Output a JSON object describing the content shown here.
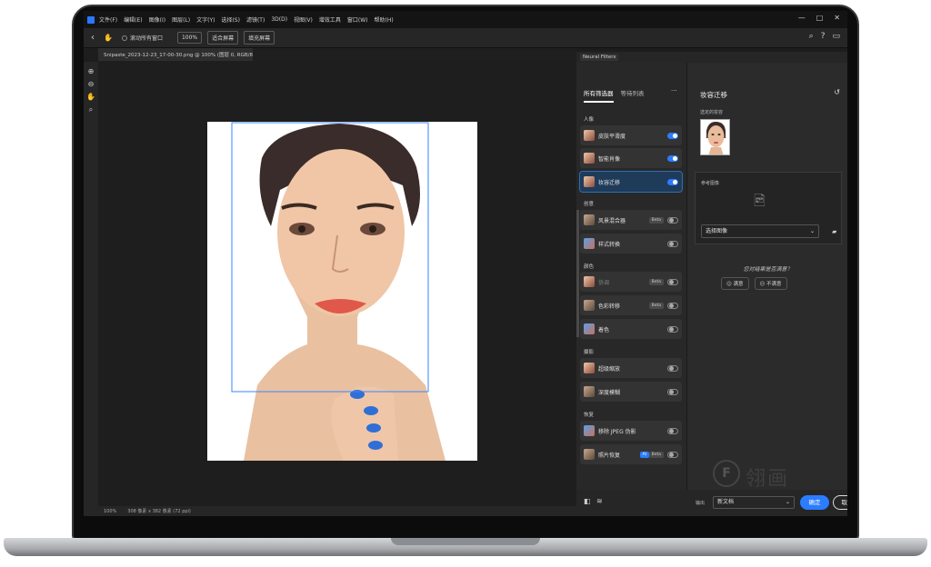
{
  "menubar": {
    "items": [
      "文件(F)",
      "编辑(E)",
      "图像(I)",
      "图层(L)",
      "文字(Y)",
      "选择(S)",
      "滤镜(T)",
      "3D(D)",
      "视图(V)",
      "增效工具",
      "窗口(W)",
      "帮助(H)"
    ],
    "window_controls": [
      "—",
      "□",
      "✕"
    ]
  },
  "optbar": {
    "back": "‹",
    "hand": "✋",
    "scroll_all": "滚动所有窗口",
    "zoom": "100%",
    "fit_screen": "适合屏幕",
    "fill_screen": "填充屏幕"
  },
  "document": {
    "tab_title": "Snipaste_2023-12-23_17-00-30.png @ 100% (图层 0, RGB/8#) *",
    "status_zoom": "100%",
    "status_size": "308 像素 x 382 像素 (72 ppi)"
  },
  "neural": {
    "header_tab": "Neural Filters",
    "tabs": [
      "所有筛选器",
      "等待列表"
    ],
    "more": "···",
    "categories": {
      "portrait": "人像",
      "creative": "创意",
      "color": "颜色",
      "photography": "摄影",
      "restoration": "恢复"
    },
    "filters": [
      {
        "label": "皮肤平滑度"
      },
      {
        "label": "智能肖像"
      },
      {
        "label": "妆容迁移"
      },
      {
        "label": "风景混合器",
        "badge": "Beta"
      },
      {
        "label": "样式转换"
      },
      {
        "label": "协调",
        "badge": "Beta"
      },
      {
        "label": "色彩转移",
        "badge": "Beta"
      },
      {
        "label": "着色"
      },
      {
        "label": "超级缩放"
      },
      {
        "label": "深度模糊"
      },
      {
        "label": "移除 JPEG 伪影"
      },
      {
        "label": "照片恢复",
        "badge": "Beta",
        "ai": "AI"
      }
    ]
  },
  "settings": {
    "title": "妆容迁移",
    "reset": "↺",
    "selected_label": "选定的妆容",
    "reference_label": "参考图像",
    "select_image": "选择图像",
    "satisfied_question": "您对结果是否满意？",
    "satisfied": "满意",
    "not_satisfied": "不满意",
    "watermark_text": "翎画"
  },
  "bottombar": {
    "output_label": "输出",
    "output_value": "新文档",
    "ok": "确定",
    "cancel": "取消"
  }
}
